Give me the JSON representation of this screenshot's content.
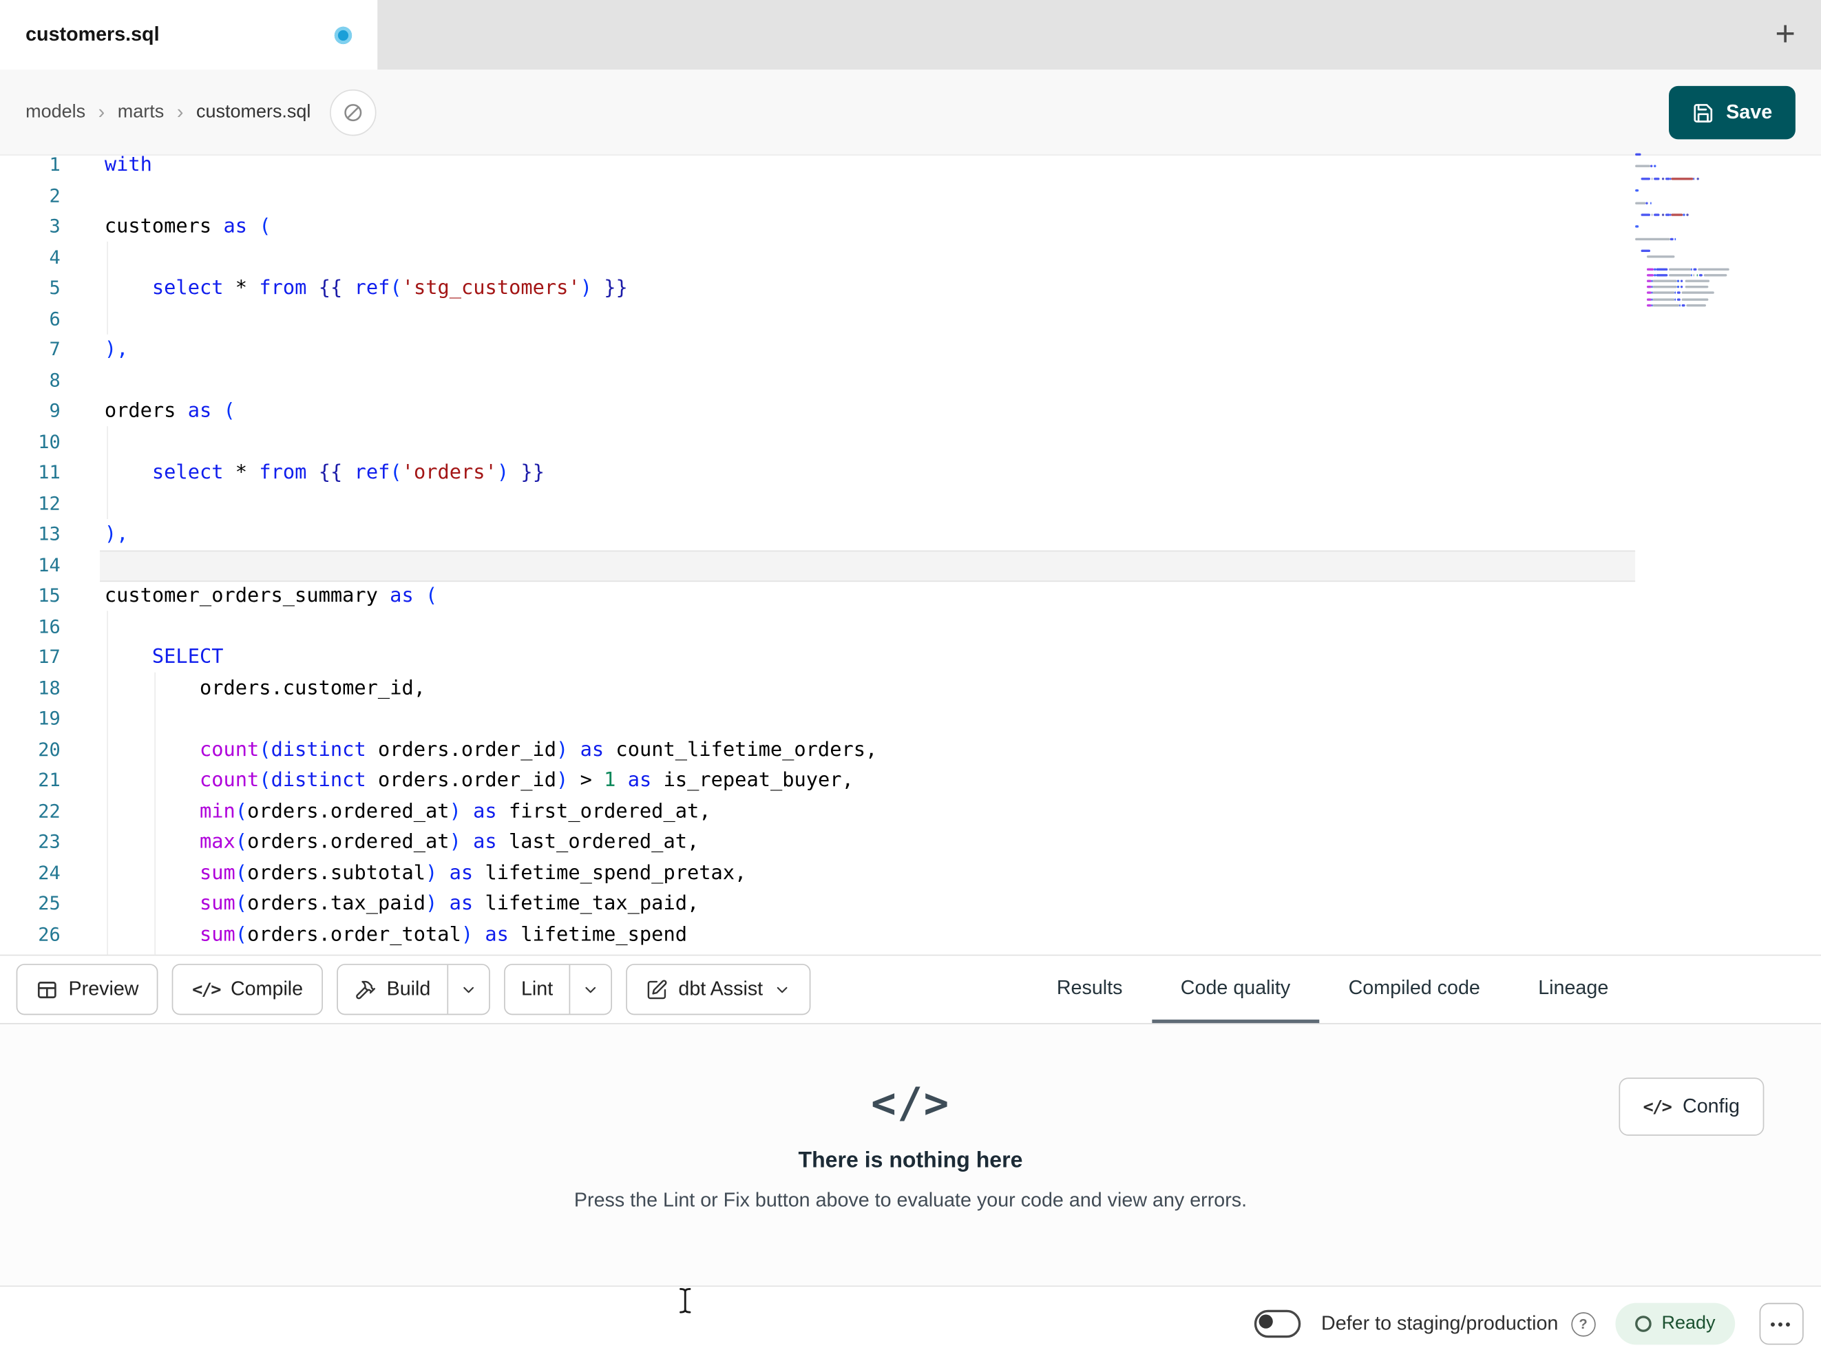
{
  "tab_bar": {
    "active_tab": "customers.sql"
  },
  "breadcrumb": {
    "items": [
      "models",
      "marts",
      "customers.sql"
    ]
  },
  "actions": {
    "save": "Save"
  },
  "icons": {
    "plus": "+",
    "code_tag": "</>",
    "crumb_sep": "›",
    "help": "?",
    "ellipsis": "•••"
  },
  "editor": {
    "active_line": 14,
    "lines": [
      [
        [
          "with",
          "kw"
        ]
      ],
      [],
      [
        [
          "customers ",
          "plain"
        ],
        [
          "as",
          "kw"
        ],
        [
          " ",
          "plain"
        ],
        [
          "(",
          "paren"
        ]
      ],
      [],
      [
        [
          "    ",
          "plain"
        ],
        [
          "select",
          "kw"
        ],
        [
          " ",
          "plain"
        ],
        [
          "*",
          "plain"
        ],
        [
          " ",
          "plain"
        ],
        [
          "from",
          "kw"
        ],
        [
          " ",
          "plain"
        ],
        [
          "{{",
          "jinja"
        ],
        [
          " ",
          "plain"
        ],
        [
          "ref",
          "kw"
        ],
        [
          "(",
          "paren"
        ],
        [
          "'stg_customers'",
          "str"
        ],
        [
          ")",
          "paren"
        ],
        [
          " ",
          "plain"
        ],
        [
          "}}",
          "jinja"
        ]
      ],
      [],
      [
        [
          "),",
          "paren"
        ]
      ],
      [],
      [
        [
          "orders ",
          "plain"
        ],
        [
          "as",
          "kw"
        ],
        [
          " ",
          "plain"
        ],
        [
          "(",
          "paren"
        ]
      ],
      [],
      [
        [
          "    ",
          "plain"
        ],
        [
          "select",
          "kw"
        ],
        [
          " ",
          "plain"
        ],
        [
          "*",
          "plain"
        ],
        [
          " ",
          "plain"
        ],
        [
          "from",
          "kw"
        ],
        [
          " ",
          "plain"
        ],
        [
          "{{",
          "jinja"
        ],
        [
          " ",
          "plain"
        ],
        [
          "ref",
          "kw"
        ],
        [
          "(",
          "paren"
        ],
        [
          "'orders'",
          "str"
        ],
        [
          ")",
          "paren"
        ],
        [
          " ",
          "plain"
        ],
        [
          "}}",
          "jinja"
        ]
      ],
      [],
      [
        [
          "),",
          "paren"
        ]
      ],
      [],
      [
        [
          "customer_orders_summary ",
          "plain"
        ],
        [
          "as",
          "kw"
        ],
        [
          " ",
          "plain"
        ],
        [
          "(",
          "paren"
        ]
      ],
      [],
      [
        [
          "    ",
          "plain"
        ],
        [
          "SELECT",
          "kw"
        ]
      ],
      [
        [
          "        ",
          "plain"
        ],
        [
          "orders.customer_id,",
          "plain"
        ]
      ],
      [],
      [
        [
          "        ",
          "plain"
        ],
        [
          "count",
          "fn"
        ],
        [
          "(",
          "paren"
        ],
        [
          "distinct",
          "kw"
        ],
        [
          " ",
          "plain"
        ],
        [
          "orders.order_id",
          "plain"
        ],
        [
          ")",
          "paren"
        ],
        [
          " ",
          "plain"
        ],
        [
          "as",
          "kw"
        ],
        [
          " ",
          "plain"
        ],
        [
          "count_lifetime_orders,",
          "plain"
        ]
      ],
      [
        [
          "        ",
          "plain"
        ],
        [
          "count",
          "fn"
        ],
        [
          "(",
          "paren"
        ],
        [
          "distinct",
          "kw"
        ],
        [
          " ",
          "plain"
        ],
        [
          "orders.order_id",
          "plain"
        ],
        [
          ")",
          "paren"
        ],
        [
          " ",
          "plain"
        ],
        [
          ">",
          "plain"
        ],
        [
          " ",
          "plain"
        ],
        [
          "1",
          "num"
        ],
        [
          " ",
          "plain"
        ],
        [
          "as",
          "kw"
        ],
        [
          " ",
          "plain"
        ],
        [
          "is_repeat_buyer,",
          "plain"
        ]
      ],
      [
        [
          "        ",
          "plain"
        ],
        [
          "min",
          "fn"
        ],
        [
          "(",
          "paren"
        ],
        [
          "orders.ordered_at",
          "plain"
        ],
        [
          ")",
          "paren"
        ],
        [
          " ",
          "plain"
        ],
        [
          "as",
          "kw"
        ],
        [
          " ",
          "plain"
        ],
        [
          "first_ordered_at,",
          "plain"
        ]
      ],
      [
        [
          "        ",
          "plain"
        ],
        [
          "max",
          "fn"
        ],
        [
          "(",
          "paren"
        ],
        [
          "orders.ordered_at",
          "plain"
        ],
        [
          ")",
          "paren"
        ],
        [
          " ",
          "plain"
        ],
        [
          "as",
          "kw"
        ],
        [
          " ",
          "plain"
        ],
        [
          "last_ordered_at,",
          "plain"
        ]
      ],
      [
        [
          "        ",
          "plain"
        ],
        [
          "sum",
          "fn"
        ],
        [
          "(",
          "paren"
        ],
        [
          "orders.subtotal",
          "plain"
        ],
        [
          ")",
          "paren"
        ],
        [
          " ",
          "plain"
        ],
        [
          "as",
          "kw"
        ],
        [
          " ",
          "plain"
        ],
        [
          "lifetime_spend_pretax,",
          "plain"
        ]
      ],
      [
        [
          "        ",
          "plain"
        ],
        [
          "sum",
          "fn"
        ],
        [
          "(",
          "paren"
        ],
        [
          "orders.tax_paid",
          "plain"
        ],
        [
          ")",
          "paren"
        ],
        [
          " ",
          "plain"
        ],
        [
          "as",
          "kw"
        ],
        [
          " ",
          "plain"
        ],
        [
          "lifetime_tax_paid,",
          "plain"
        ]
      ],
      [
        [
          "        ",
          "plain"
        ],
        [
          "sum",
          "fn"
        ],
        [
          "(",
          "paren"
        ],
        [
          "orders.order_total",
          "plain"
        ],
        [
          ")",
          "paren"
        ],
        [
          " ",
          "plain"
        ],
        [
          "as",
          "kw"
        ],
        [
          " ",
          "plain"
        ],
        [
          "lifetime_spend",
          "plain"
        ]
      ]
    ]
  },
  "toolbar": {
    "preview": "Preview",
    "compile": "Compile",
    "build": "Build",
    "lint": "Lint",
    "dbt_assist": "dbt Assist"
  },
  "panel_tabs": [
    {
      "label": "Results",
      "active": false
    },
    {
      "label": "Code quality",
      "active": true
    },
    {
      "label": "Compiled code",
      "active": false
    },
    {
      "label": "Lineage",
      "active": false
    }
  ],
  "empty_state": {
    "title": "There is nothing here",
    "subtitle": "Press the Lint or Fix button above to evaluate your code and view any errors.",
    "config": "Config"
  },
  "status_bar": {
    "defer_label": "Defer to staging/production",
    "ready_label": "Ready"
  },
  "colors": {
    "accent": "#00555d",
    "dot": "#1b9fd8",
    "kw": "#0f1ded",
    "fn": "#af00db",
    "str": "#a31515",
    "num": "#098658",
    "jinja": "#1b1ba8",
    "paren": "#0431fa",
    "line_number": "#237893",
    "ready_bg": "#e7f4eb",
    "ready_text": "#1b5130"
  }
}
